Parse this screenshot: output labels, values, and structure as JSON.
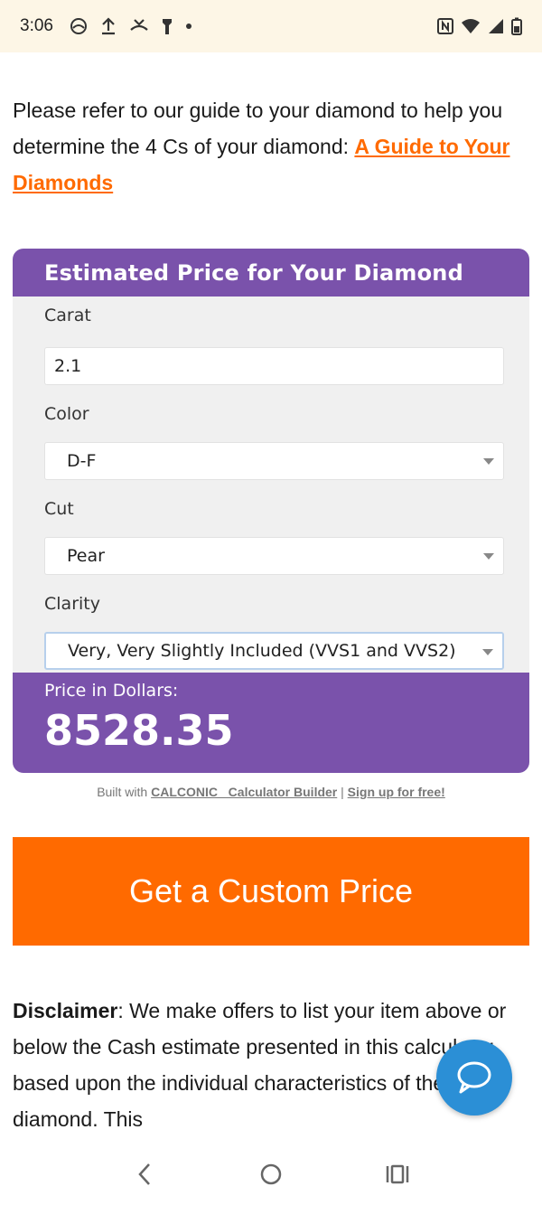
{
  "status_bar": {
    "time": "3:06"
  },
  "intro": {
    "text": "Please refer to our guide to your diamond to help you determine the 4 Cs of your diamond: ",
    "link_label": "A Guide to Your Diamonds"
  },
  "calculator": {
    "title": "Estimated Price for Your Diamond",
    "carat": {
      "label": "Carat",
      "value": "2.1"
    },
    "color": {
      "label": "Color",
      "value": "D-F"
    },
    "cut": {
      "label": "Cut",
      "value": "Pear"
    },
    "clarity": {
      "label": "Clarity",
      "value": "Very, Very Slightly Included (VVS1 and VVS2)"
    },
    "price_label": "Price in Dollars:",
    "price_value": "8528.35",
    "accent_color": "#7a52ab"
  },
  "built_with": {
    "prefix": "Built with ",
    "builder_link": "CALCONIC_ Calculator Builder",
    "separator": " | ",
    "signup_link": "Sign up for free!"
  },
  "cta": {
    "label": "Get a Custom Price",
    "color": "#ff6a00"
  },
  "disclaimer": {
    "heading": "Disclaimer",
    "text": ": We make offers to list your item above or below the Cash estimate presented in this calculator based upon the individual characteristics of the diamond. This"
  },
  "icons": {
    "chat": "chat-bubble-icon",
    "back": "back-chevron-icon",
    "home": "home-circle-icon",
    "recents": "recents-icon"
  }
}
